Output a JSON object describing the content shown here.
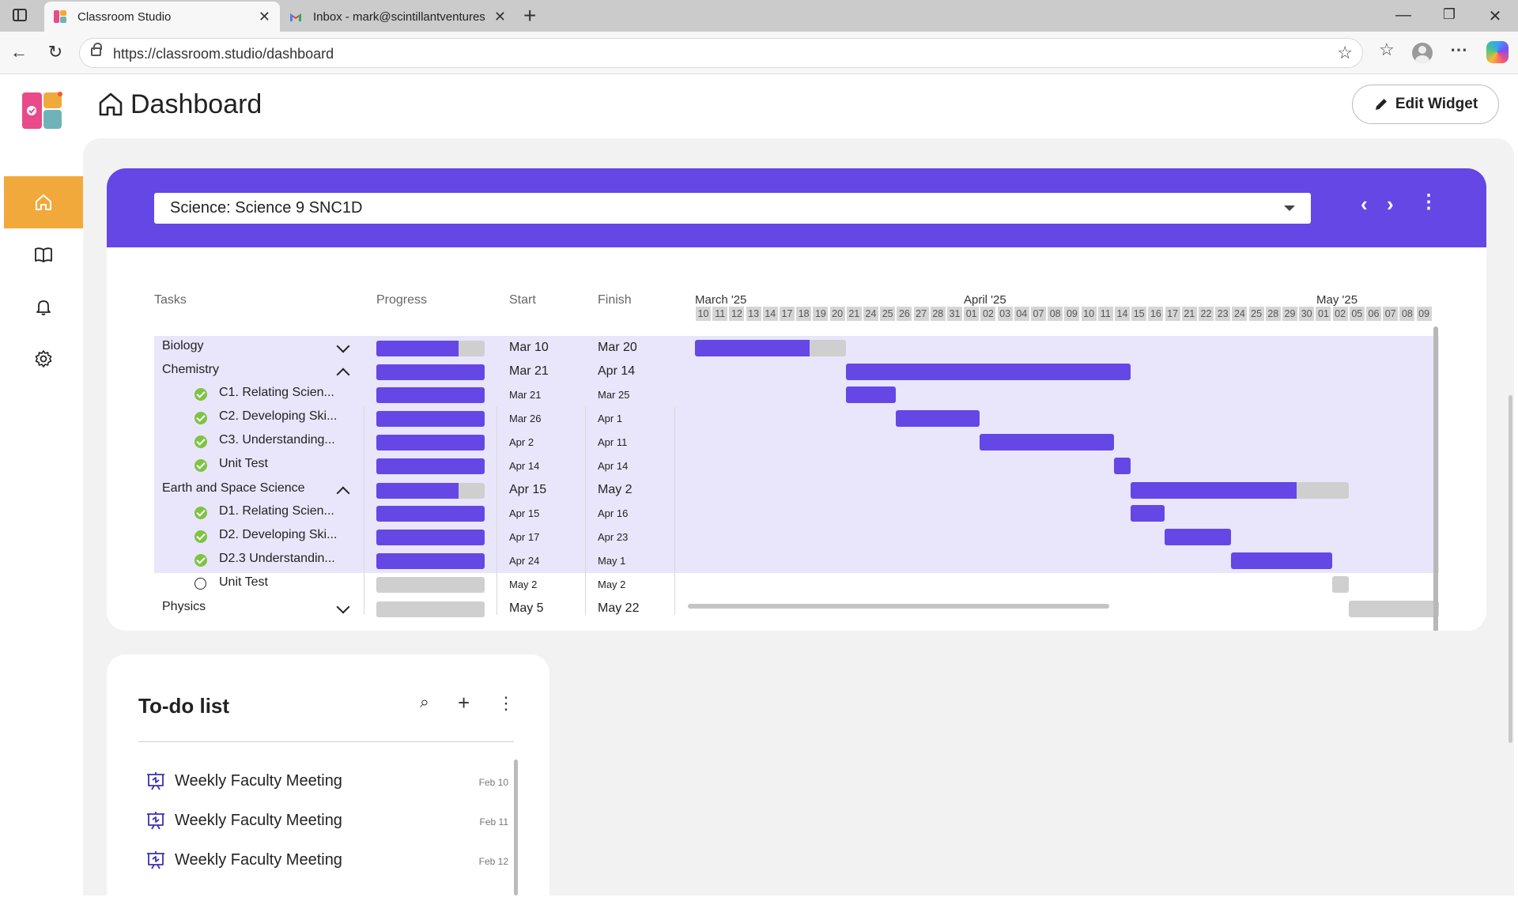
{
  "browser": {
    "tabs": [
      {
        "title": "Classroom Studio",
        "active": true,
        "icon": "classroom-studio-favicon"
      },
      {
        "title": "Inbox - mark@scintillantventures",
        "active": false,
        "icon": "gmail-favicon"
      }
    ],
    "url": "https://classroom.studio/dashboard"
  },
  "app": {
    "nav": [
      {
        "name": "home",
        "icon": "home-icon",
        "active": true
      },
      {
        "name": "courses",
        "icon": "book-icon",
        "active": false
      },
      {
        "name": "notifications",
        "icon": "bell-icon",
        "active": false
      },
      {
        "name": "settings",
        "icon": "gear-icon",
        "active": false
      }
    ],
    "page_title": "Dashboard",
    "edit_widget_label": "Edit Widget",
    "accent_color": "#6547e6",
    "nav_active_color": "#f2a93b"
  },
  "gantt": {
    "course": "Science: Science 9 SNC1D",
    "columns": {
      "tasks": "Tasks",
      "progress": "Progress",
      "start": "Start",
      "finish": "Finish"
    },
    "months": [
      "March '25",
      "April '25",
      "May '25"
    ],
    "days": [
      "10",
      "11",
      "12",
      "13",
      "14",
      "17",
      "18",
      "19",
      "20",
      "21",
      "24",
      "25",
      "26",
      "27",
      "28",
      "31",
      "01",
      "02",
      "03",
      "04",
      "07",
      "08",
      "09",
      "10",
      "11",
      "14",
      "15",
      "16",
      "17",
      "21",
      "22",
      "23",
      "24",
      "25",
      "28",
      "29",
      "30",
      "01",
      "02",
      "05",
      "06",
      "07",
      "08",
      "09"
    ],
    "rows": [
      {
        "label": "Biology",
        "type": "unit",
        "expanded": false,
        "progress": 0.76,
        "start": "Mar 10",
        "finish": "Mar 20"
      },
      {
        "label": "Chemistry",
        "type": "unit",
        "expanded": true,
        "progress": 1.0,
        "start": "Mar 21",
        "finish": "Apr 14"
      },
      {
        "label": "C1. Relating Scien...",
        "type": "task",
        "done": true,
        "progress": 1.0,
        "start": "Mar 21",
        "finish": "Mar 25"
      },
      {
        "label": "C2. Developing Ski...",
        "type": "task",
        "done": true,
        "progress": 1.0,
        "start": "Mar 26",
        "finish": "Apr 1"
      },
      {
        "label": "C3. Understanding...",
        "type": "task",
        "done": true,
        "progress": 1.0,
        "start": "Apr 2",
        "finish": "Apr 11"
      },
      {
        "label": "Unit Test",
        "type": "task",
        "done": true,
        "progress": 1.0,
        "start": "Apr 14",
        "finish": "Apr 14"
      },
      {
        "label": "Earth and Space Science",
        "type": "unit",
        "expanded": true,
        "progress": 0.76,
        "start": "Apr 15",
        "finish": "May 2"
      },
      {
        "label": "D1. Relating Scien...",
        "type": "task",
        "done": true,
        "progress": 1.0,
        "start": "Apr 15",
        "finish": "Apr 16"
      },
      {
        "label": "D2. Developing Ski...",
        "type": "task",
        "done": true,
        "progress": 1.0,
        "start": "Apr 17",
        "finish": "Apr 23"
      },
      {
        "label": "D2.3 Understandin...",
        "type": "task",
        "done": true,
        "progress": 1.0,
        "start": "Apr 24",
        "finish": "May 1"
      },
      {
        "label": "Unit Test",
        "type": "task",
        "done": false,
        "progress": 0.0,
        "start": "May 2",
        "finish": "May 2"
      },
      {
        "label": "Physics",
        "type": "unit",
        "expanded": false,
        "progress": 0.0,
        "start": "May 5",
        "finish": "May 22"
      }
    ]
  },
  "todo": {
    "title": "To-do list",
    "items": [
      {
        "text": "Weekly Faculty Meeting",
        "date": "Feb 10",
        "icon": "presentation-board-icon"
      },
      {
        "text": "Weekly Faculty Meeting",
        "date": "Feb 11",
        "icon": "presentation-board-icon"
      },
      {
        "text": "Weekly Faculty Meeting",
        "date": "Feb 12",
        "icon": "presentation-board-icon"
      }
    ]
  }
}
